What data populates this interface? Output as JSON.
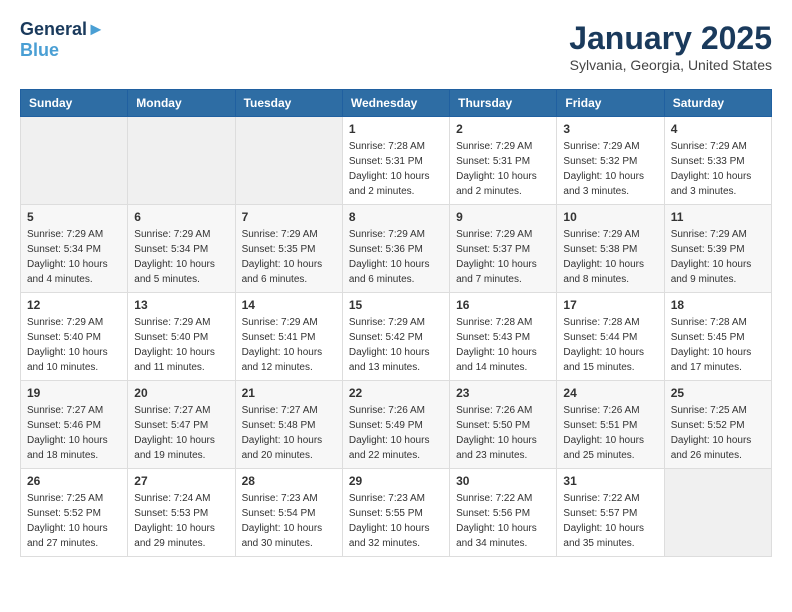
{
  "header": {
    "logo_line1": "General",
    "logo_line2": "Blue",
    "month_title": "January 2025",
    "subtitle": "Sylvania, Georgia, United States"
  },
  "days_of_week": [
    "Sunday",
    "Monday",
    "Tuesday",
    "Wednesday",
    "Thursday",
    "Friday",
    "Saturday"
  ],
  "weeks": [
    [
      {
        "day": "",
        "info": ""
      },
      {
        "day": "",
        "info": ""
      },
      {
        "day": "",
        "info": ""
      },
      {
        "day": "1",
        "info": "Sunrise: 7:28 AM\nSunset: 5:31 PM\nDaylight: 10 hours\nand 2 minutes."
      },
      {
        "day": "2",
        "info": "Sunrise: 7:29 AM\nSunset: 5:31 PM\nDaylight: 10 hours\nand 2 minutes."
      },
      {
        "day": "3",
        "info": "Sunrise: 7:29 AM\nSunset: 5:32 PM\nDaylight: 10 hours\nand 3 minutes."
      },
      {
        "day": "4",
        "info": "Sunrise: 7:29 AM\nSunset: 5:33 PM\nDaylight: 10 hours\nand 3 minutes."
      }
    ],
    [
      {
        "day": "5",
        "info": "Sunrise: 7:29 AM\nSunset: 5:34 PM\nDaylight: 10 hours\nand 4 minutes."
      },
      {
        "day": "6",
        "info": "Sunrise: 7:29 AM\nSunset: 5:34 PM\nDaylight: 10 hours\nand 5 minutes."
      },
      {
        "day": "7",
        "info": "Sunrise: 7:29 AM\nSunset: 5:35 PM\nDaylight: 10 hours\nand 6 minutes."
      },
      {
        "day": "8",
        "info": "Sunrise: 7:29 AM\nSunset: 5:36 PM\nDaylight: 10 hours\nand 6 minutes."
      },
      {
        "day": "9",
        "info": "Sunrise: 7:29 AM\nSunset: 5:37 PM\nDaylight: 10 hours\nand 7 minutes."
      },
      {
        "day": "10",
        "info": "Sunrise: 7:29 AM\nSunset: 5:38 PM\nDaylight: 10 hours\nand 8 minutes."
      },
      {
        "day": "11",
        "info": "Sunrise: 7:29 AM\nSunset: 5:39 PM\nDaylight: 10 hours\nand 9 minutes."
      }
    ],
    [
      {
        "day": "12",
        "info": "Sunrise: 7:29 AM\nSunset: 5:40 PM\nDaylight: 10 hours\nand 10 minutes."
      },
      {
        "day": "13",
        "info": "Sunrise: 7:29 AM\nSunset: 5:40 PM\nDaylight: 10 hours\nand 11 minutes."
      },
      {
        "day": "14",
        "info": "Sunrise: 7:29 AM\nSunset: 5:41 PM\nDaylight: 10 hours\nand 12 minutes."
      },
      {
        "day": "15",
        "info": "Sunrise: 7:29 AM\nSunset: 5:42 PM\nDaylight: 10 hours\nand 13 minutes."
      },
      {
        "day": "16",
        "info": "Sunrise: 7:28 AM\nSunset: 5:43 PM\nDaylight: 10 hours\nand 14 minutes."
      },
      {
        "day": "17",
        "info": "Sunrise: 7:28 AM\nSunset: 5:44 PM\nDaylight: 10 hours\nand 15 minutes."
      },
      {
        "day": "18",
        "info": "Sunrise: 7:28 AM\nSunset: 5:45 PM\nDaylight: 10 hours\nand 17 minutes."
      }
    ],
    [
      {
        "day": "19",
        "info": "Sunrise: 7:27 AM\nSunset: 5:46 PM\nDaylight: 10 hours\nand 18 minutes."
      },
      {
        "day": "20",
        "info": "Sunrise: 7:27 AM\nSunset: 5:47 PM\nDaylight: 10 hours\nand 19 minutes."
      },
      {
        "day": "21",
        "info": "Sunrise: 7:27 AM\nSunset: 5:48 PM\nDaylight: 10 hours\nand 20 minutes."
      },
      {
        "day": "22",
        "info": "Sunrise: 7:26 AM\nSunset: 5:49 PM\nDaylight: 10 hours\nand 22 minutes."
      },
      {
        "day": "23",
        "info": "Sunrise: 7:26 AM\nSunset: 5:50 PM\nDaylight: 10 hours\nand 23 minutes."
      },
      {
        "day": "24",
        "info": "Sunrise: 7:26 AM\nSunset: 5:51 PM\nDaylight: 10 hours\nand 25 minutes."
      },
      {
        "day": "25",
        "info": "Sunrise: 7:25 AM\nSunset: 5:52 PM\nDaylight: 10 hours\nand 26 minutes."
      }
    ],
    [
      {
        "day": "26",
        "info": "Sunrise: 7:25 AM\nSunset: 5:52 PM\nDaylight: 10 hours\nand 27 minutes."
      },
      {
        "day": "27",
        "info": "Sunrise: 7:24 AM\nSunset: 5:53 PM\nDaylight: 10 hours\nand 29 minutes."
      },
      {
        "day": "28",
        "info": "Sunrise: 7:23 AM\nSunset: 5:54 PM\nDaylight: 10 hours\nand 30 minutes."
      },
      {
        "day": "29",
        "info": "Sunrise: 7:23 AM\nSunset: 5:55 PM\nDaylight: 10 hours\nand 32 minutes."
      },
      {
        "day": "30",
        "info": "Sunrise: 7:22 AM\nSunset: 5:56 PM\nDaylight: 10 hours\nand 34 minutes."
      },
      {
        "day": "31",
        "info": "Sunrise: 7:22 AM\nSunset: 5:57 PM\nDaylight: 10 hours\nand 35 minutes."
      },
      {
        "day": "",
        "info": ""
      }
    ]
  ]
}
